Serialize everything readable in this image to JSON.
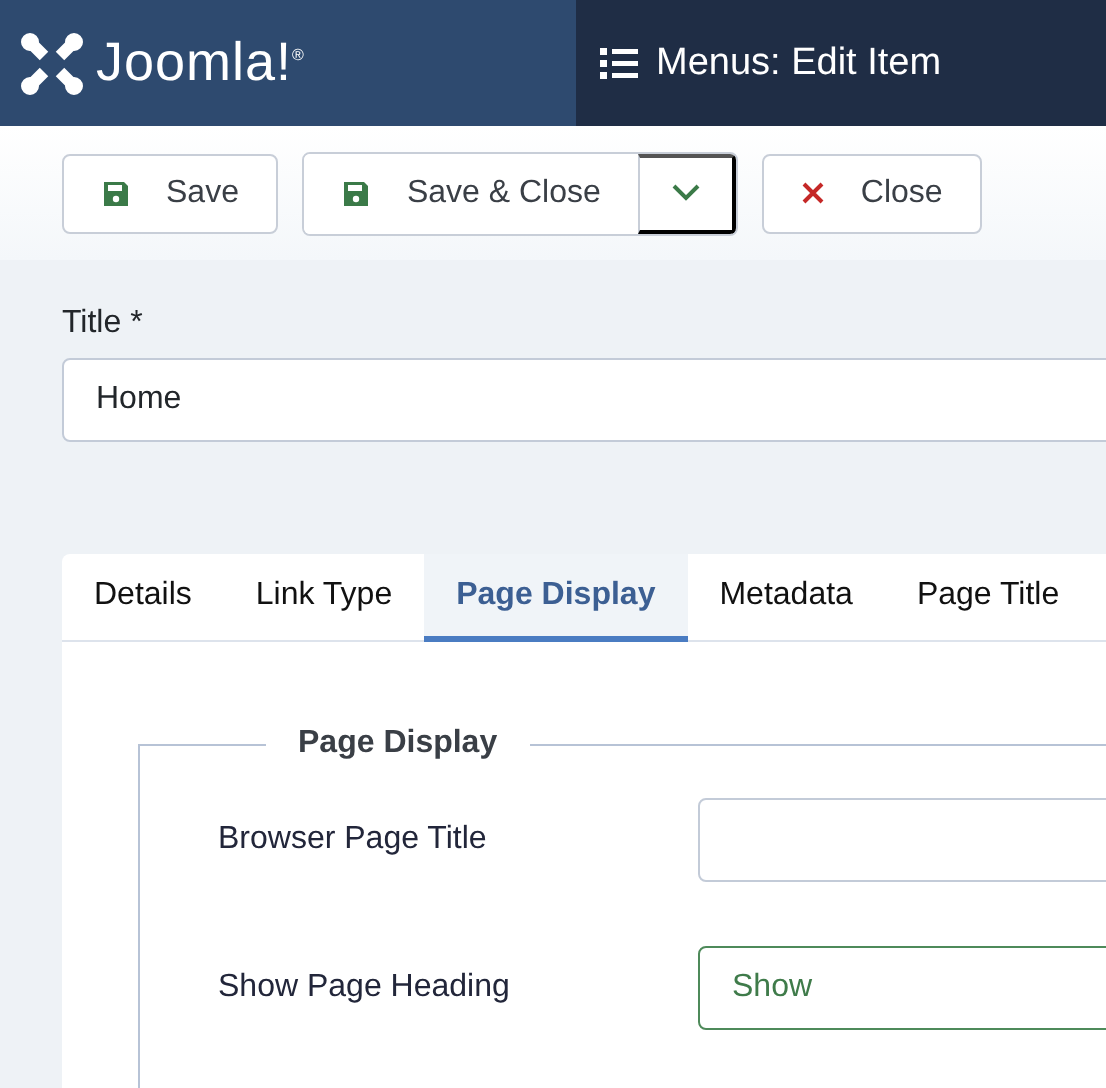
{
  "header": {
    "logo_text": "Joomla!$^{®}$",
    "title": "Menus: Edit Item"
  },
  "toolbar": [
    {
      "kind": "save",
      "label": "Save"
    },
    {
      "kind": "split",
      "label": "Save & Close"
    },
    {
      "kind": "close",
      "label": "Close"
    }
  ],
  "title_field": {
    "label": "Title *",
    "value": "Home"
  },
  "tabs": [
    {
      "label": "Details",
      "selected": false
    },
    {
      "label": "Link Type",
      "selected": false
    },
    {
      "label": "Page Display",
      "selected": true
    },
    {
      "label": "Metadata",
      "selected": false
    },
    {
      "label": "Page Title",
      "selected": false
    }
  ],
  "fieldset": {
    "legend": "Page Display",
    "fields": [
      {
        "kind": "text",
        "label": "Browser Page Title"
      },
      {
        "kind": "select",
        "label": "Show Page Heading",
        "value": "Show"
      }
    ]
  }
}
